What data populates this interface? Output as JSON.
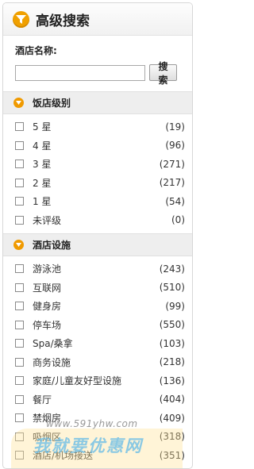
{
  "header": {
    "title": "高级搜索",
    "icon": "filter-funnel-icon"
  },
  "hotel_name": {
    "label": "酒店名称:",
    "input_value": "",
    "search_button": "搜索"
  },
  "star_section": {
    "title": "饭店级别",
    "items": [
      {
        "label": "5 星",
        "count": "(19)"
      },
      {
        "label": "4 星",
        "count": "(96)"
      },
      {
        "label": "3 星",
        "count": "(271)"
      },
      {
        "label": "2 星",
        "count": "(217)"
      },
      {
        "label": "1 星",
        "count": "(54)"
      },
      {
        "label": "未评级",
        "count": "(0)"
      }
    ]
  },
  "facility_section": {
    "title": "酒店设施",
    "items": [
      {
        "label": "游泳池",
        "count": "(243)"
      },
      {
        "label": "互联网",
        "count": "(510)"
      },
      {
        "label": "健身房",
        "count": "(99)"
      },
      {
        "label": "停车场",
        "count": "(550)"
      },
      {
        "label": "Spa/桑拿",
        "count": "(103)"
      },
      {
        "label": "商务设施",
        "count": "(218)"
      },
      {
        "label": "家庭/儿童友好型设施",
        "count": "(136)"
      },
      {
        "label": "餐厅",
        "count": "(404)"
      },
      {
        "label": "禁烟房",
        "count": "(409)"
      },
      {
        "label": "吸烟区",
        "count": "(318)"
      },
      {
        "label": "酒店/机场接送",
        "count": "(351)"
      }
    ]
  },
  "watermark": {
    "url": "www.591yhw.com",
    "text": "我就要优惠网"
  },
  "colors": {
    "accent": "#f0a000",
    "section_bg": "#eeeeee",
    "border": "#d7d7d7"
  }
}
